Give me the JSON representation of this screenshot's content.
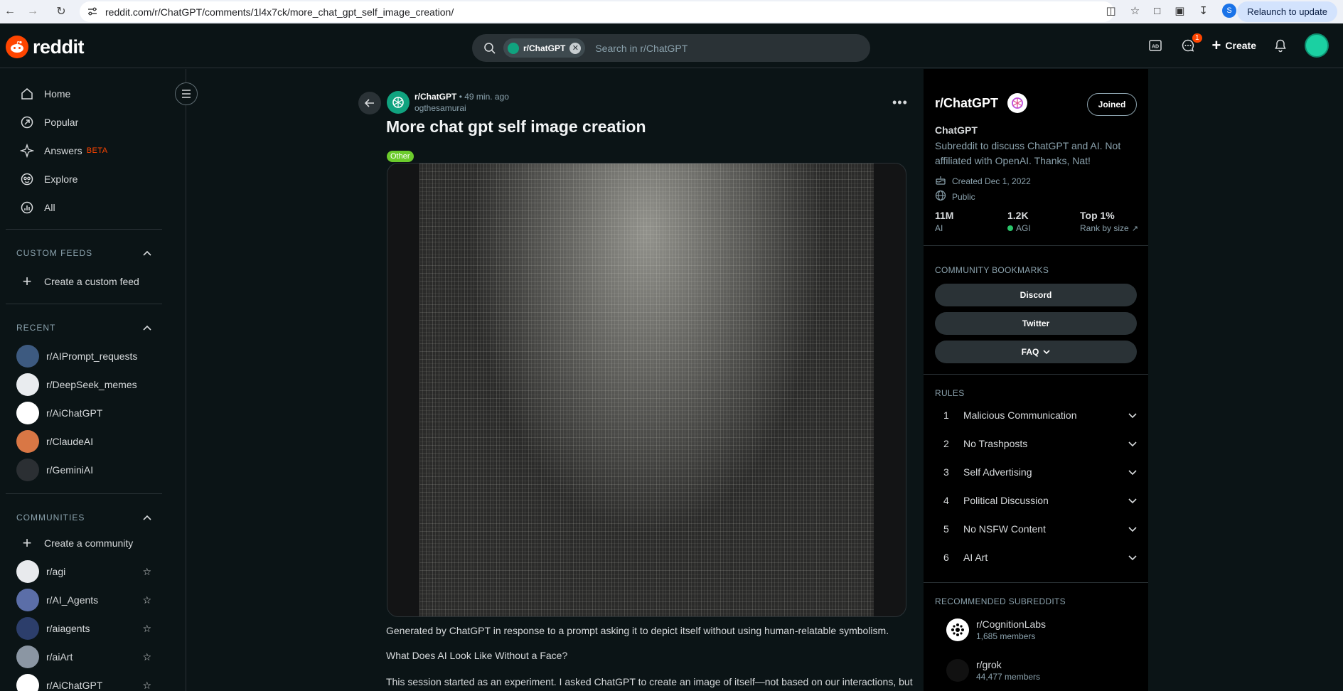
{
  "browser": {
    "url": "reddit.com/r/ChatGPT/comments/1l4x7ck/more_chat_gpt_self_image_creation/",
    "relaunch_label": "Relaunch to update",
    "profile_initial": "S"
  },
  "header": {
    "logo_text": "reddit",
    "search_chip": "r/ChatGPT",
    "search_placeholder": "Search in r/ChatGPT",
    "chat_badge": "1",
    "create_label": "Create"
  },
  "sidebar": {
    "nav": [
      {
        "label": "Home",
        "icon": "home-icon"
      },
      {
        "label": "Popular",
        "icon": "popular-icon"
      },
      {
        "label": "Answers",
        "icon": "answers-icon",
        "badge": "BETA"
      },
      {
        "label": "Explore",
        "icon": "explore-icon"
      },
      {
        "label": "All",
        "icon": "all-icon"
      }
    ],
    "custom_feeds_title": "CUSTOM FEEDS",
    "create_custom_feed": "Create a custom feed",
    "recent_title": "RECENT",
    "recent": [
      {
        "name": "r/AIPrompt_requests",
        "color": "#3d5a80"
      },
      {
        "name": "r/DeepSeek_memes",
        "color": "#e9ecef"
      },
      {
        "name": "r/AiChatGPT",
        "color": "#ffffff"
      },
      {
        "name": "r/ClaudeAI",
        "color": "#d97745"
      },
      {
        "name": "r/GeminiAI",
        "color": "#2b2f33"
      }
    ],
    "communities_title": "COMMUNITIES",
    "create_community": "Create a community",
    "communities": [
      {
        "name": "r/agi",
        "color": "#e8eaed"
      },
      {
        "name": "r/AI_Agents",
        "color": "#5b6ea8"
      },
      {
        "name": "r/aiagents",
        "color": "#2c3e6b"
      },
      {
        "name": "r/aiArt",
        "color": "#8b96a3"
      },
      {
        "name": "r/AiChatGPT",
        "color": "#ffffff"
      }
    ]
  },
  "post": {
    "subreddit": "r/ChatGPT",
    "time": "• 49 min. ago",
    "author": "ogthesamurai",
    "title": "More chat gpt self image creation",
    "flair": "Other",
    "flair_color": "#6ccb2c",
    "para1": "Generated by ChatGPT in response to a prompt asking it to depict itself without using human-relatable symbolism.",
    "para2": "What Does AI Look Like Without a Face?",
    "para3": "This session started as an experiment. I asked ChatGPT to create an image of itself—not based on our interactions, but"
  },
  "community": {
    "name": "r/ChatGPT",
    "joined_label": "Joined",
    "title": "ChatGPT",
    "description": "Subreddit to discuss ChatGPT and AI. Not affiliated with OpenAI. Thanks, Nat!",
    "created": "Created Dec 1, 2022",
    "visibility": "Public",
    "stats": [
      {
        "value": "11M",
        "label": "AI"
      },
      {
        "value": "1.2K",
        "label": "AGI",
        "online": true
      },
      {
        "value": "Top 1%",
        "label": "Rank by size"
      }
    ],
    "bookmarks_title": "COMMUNITY BOOKMARKS",
    "bookmarks": [
      "Discord",
      "Twitter",
      "FAQ"
    ],
    "rules_title": "RULES",
    "rules": [
      {
        "num": "1",
        "text": "Malicious Communication"
      },
      {
        "num": "2",
        "text": "No Trashposts"
      },
      {
        "num": "3",
        "text": "Self Advertising"
      },
      {
        "num": "4",
        "text": "Political Discussion"
      },
      {
        "num": "5",
        "text": "No NSFW Content"
      },
      {
        "num": "6",
        "text": "AI Art"
      }
    ],
    "recommended_title": "RECOMMENDED SUBREDDITS",
    "recommended": [
      {
        "name": "r/CognitionLabs",
        "members": "1,685 members"
      },
      {
        "name": "r/grok",
        "members": "44,477 members"
      }
    ]
  },
  "colors": {
    "accent": "#ff4500",
    "background": "#0b1416",
    "brand_green": "#10a37f"
  }
}
